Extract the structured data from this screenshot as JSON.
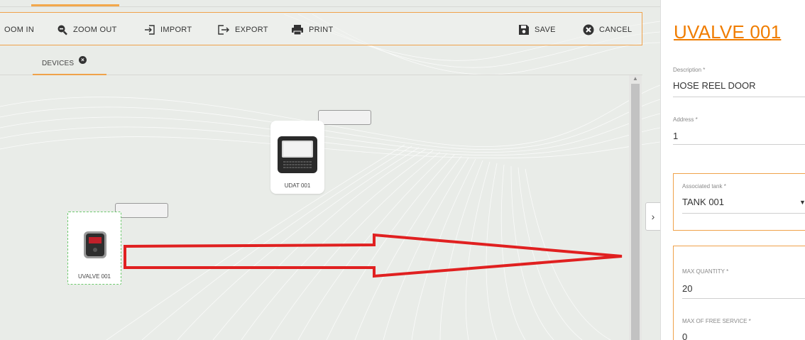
{
  "toolbar": {
    "zoom_in_label": "OOM IN",
    "zoom_out_label": "ZOOM OUT",
    "import_label": "IMPORT",
    "export_label": "EXPORT",
    "print_label": "PRINT",
    "save_label": "SAVE",
    "cancel_label": "CANCEL"
  },
  "tabs": [
    {
      "label": "DEVICES",
      "close_icon": "close-circle-icon",
      "active": true
    }
  ],
  "canvas": {
    "devices": [
      {
        "name": "UDAT 001",
        "icon": "udat-terminal-icon"
      },
      {
        "name": "UVALVE 001",
        "icon": "uvalve-device-icon",
        "selected": true
      }
    ],
    "annotation_color": "#e02020"
  },
  "panel": {
    "title": "UVALVE 001",
    "fields": {
      "description": {
        "label": "Description *",
        "value": "HOSE REEL DOOR"
      },
      "address": {
        "label": "Address *",
        "value": "1"
      },
      "associated_tank": {
        "label": "Associated tank *",
        "value": "TANK 001"
      },
      "max_quantity": {
        "label": "MAX QUANTITY *",
        "value": "20"
      },
      "max_free_service": {
        "label": "MAX OF FREE SERVICE *",
        "value": "0"
      }
    }
  },
  "colors": {
    "accent": "#f07d00",
    "border_accent": "#f0a24a",
    "canvas_bg": "#e9ece8"
  }
}
